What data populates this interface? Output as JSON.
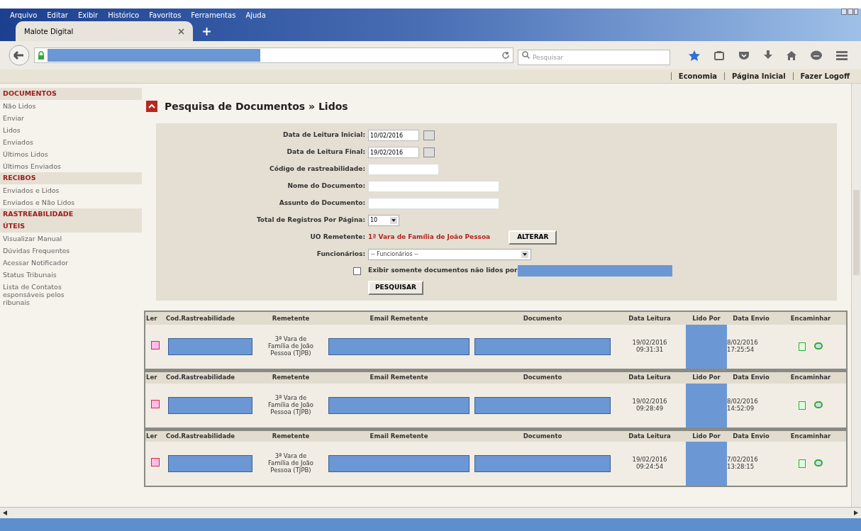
{
  "menu": [
    "Arquivo",
    "Editar",
    "Exibir",
    "Histórico",
    "Favoritos",
    "Ferramentas",
    "Ajuda"
  ],
  "tab": {
    "title": "Malote Digital",
    "selected": true
  },
  "search": {
    "placeholder": "Pesquisar"
  },
  "header_links": [
    "Economia",
    "Página Inicial",
    "Fazer Logoff"
  ],
  "sidebar": [
    {
      "title": "DOCUMENTOS",
      "items": [
        "Não Lidos",
        "Enviar",
        "Lidos",
        "Enviados",
        "Últimos Lidos",
        "Últimos Enviados"
      ]
    },
    {
      "title": "RECIBOS",
      "items": [
        "Enviados e Lidos",
        "Enviados e Não Lidos"
      ]
    },
    {
      "title": "RASTREABILIDADE"
    },
    {
      "title": "ÚTEIS",
      "items": [
        "Visualizar Manual",
        "Dúvidas Frequentes",
        "Acessar Notificador",
        "Status Tribunais",
        "Lista de Contatos\nesponsáveis pelos\nribunais"
      ]
    }
  ],
  "page_title": "Pesquisa de Documentos » Lidos",
  "form": {
    "fields": [
      {
        "label": "Data de Leitura Inicial:",
        "kind": "date",
        "value": "10/02/2016"
      },
      {
        "label": "Data de Leitura Final:",
        "kind": "date",
        "value": "19/02/2016"
      },
      {
        "label": "Código de rastreabilidade:",
        "kind": "short"
      },
      {
        "label": "Nome do Documento:",
        "kind": "text"
      },
      {
        "label": "Assunto do Documento:",
        "kind": "text"
      },
      {
        "label": "Total de Registros Por Página:",
        "kind": "small-select",
        "value": "10"
      },
      {
        "label": "UO Remetente:",
        "kind": "static",
        "value": "1ª Vara de Família de João Pessoa",
        "button": "ALTERAR"
      },
      {
        "label": "Funcionários:",
        "kind": "select",
        "value": "-- Funcionários --"
      }
    ],
    "checkbox": {
      "label": "Exibir somente documentos não lidos por",
      "checked": false
    },
    "submit": "PESQUISAR"
  },
  "table": {
    "rows": [
      {
        "columns": [
          "Ler",
          "Cod.Rastreabilidade",
          "Remetente",
          "Email Remetente",
          "Documento",
          "Data Leitura",
          "Lido Por",
          "Data Envio",
          "Encaminhar"
        ],
        "remetente": "3ª Vara de Família de João Pessoa (TJPB)",
        "data_leitura": "19/02/2016 09:31:31",
        "data_envio": "8/02/2016 17:25:54"
      },
      {
        "columns": [
          "Ler",
          "Cod.Rastreabilidade",
          "Remetente",
          "Email Remetente",
          "Documento",
          "Data Leitura",
          "Lido Por",
          "Data Envio",
          "Encaminhar"
        ],
        "remetente": "3ª Vara de Família de João Pessoa (TJPB)",
        "data_leitura": "19/02/2016 09:28:49",
        "data_envio": "8/02/2016 14:52:09"
      },
      {
        "columns": [
          "Ler",
          "Cod.Rastreabilidade",
          "Remetente",
          "Email Remetente",
          "Documento",
          "Data Leitura",
          "Lido Por",
          "Data Envio",
          "Encaminhar"
        ],
        "remetente": "3ª Vara de Família de João Pessoa (TJPB)",
        "data_leitura": "19/02/2016 09:24:54",
        "data_envio": "7/02/2016 13:28:15"
      }
    ]
  }
}
